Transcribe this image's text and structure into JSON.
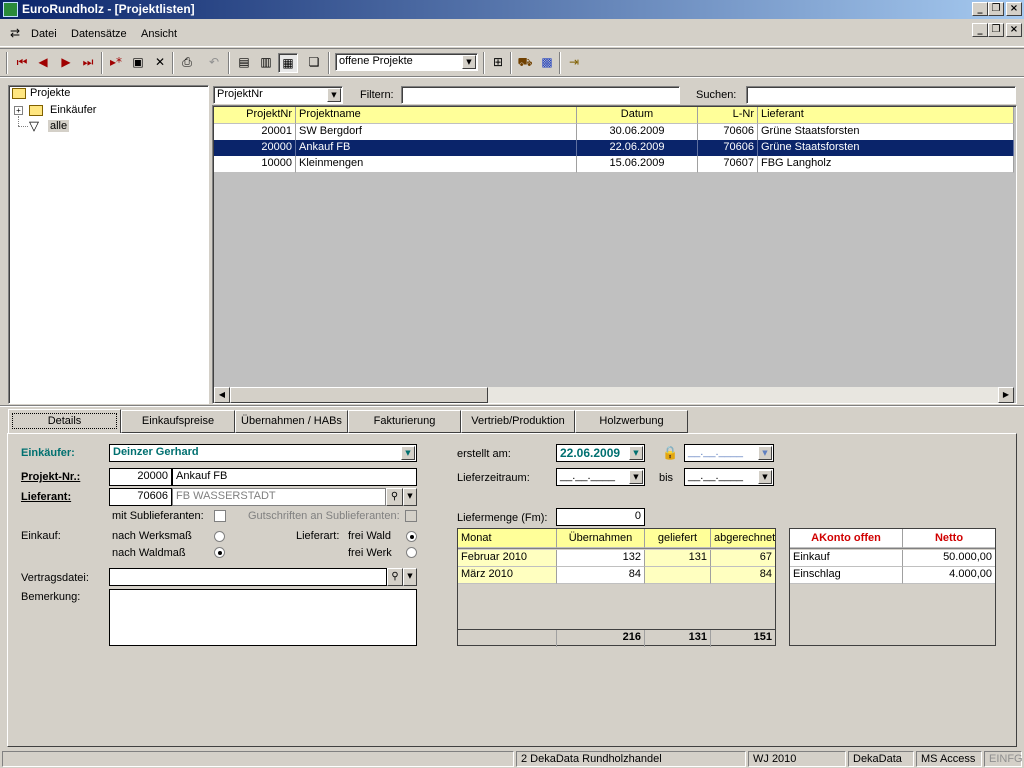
{
  "window": {
    "title": "EuroRundholz - [Projektlisten]"
  },
  "menu": {
    "items": [
      "Datei",
      "Datensätze",
      "Ansicht"
    ]
  },
  "toolbar": {
    "filter_combo": "offene Projekte"
  },
  "tree": {
    "root": "Projekte",
    "child1": "Einkäufer",
    "child2": "alle"
  },
  "list": {
    "sort_combo": "ProjektNr",
    "filter_label": "Filtern:",
    "search_label": "Suchen:",
    "columns": [
      "ProjektNr",
      "Projektname",
      "Datum",
      "L-Nr",
      "Lieferant"
    ],
    "rows": [
      [
        "20001",
        "SW Bergdorf",
        "30.06.2009",
        "70606",
        "Grüne Staatsforsten"
      ],
      [
        "20000",
        "Ankauf FB",
        "22.06.2009",
        "70606",
        "Grüne Staatsforsten"
      ],
      [
        "10000",
        "Kleinmengen",
        "15.06.2009",
        "70607",
        "FBG Langholz"
      ]
    ]
  },
  "tabs": [
    "Details",
    "Einkaufspreise",
    "Übernahmen / HABs",
    "Fakturierung",
    "Vertrieb/Produktion",
    "Holzwerbung"
  ],
  "details": {
    "einkaeufer_label": "Einkäufer:",
    "einkaeufer_value": "Deinzer Gerhard",
    "projekt_label": "Projekt-Nr.:",
    "projekt_nr": "20000",
    "projekt_name": "Ankauf FB",
    "lieferant_label": "Lieferant:",
    "lieferant_nr": "70606",
    "lieferant_name": "FB WASSERSTADT",
    "sublieferanten_label": "mit Sublieferanten:",
    "gutschriften_label": "Gutschriften an Sublieferanten:",
    "einkauf_label": "Einkauf:",
    "werksmass": "nach Werksmaß",
    "waldmass": "nach Waldmaß",
    "lieferart_label": "Lieferart:",
    "frei_wald": "frei Wald",
    "frei_werk": "frei Werk",
    "vertragsdatei_label": "Vertragsdatei:",
    "bemerkung_label": "Bemerkung:",
    "erstellt_label": "erstellt am:",
    "erstellt_value": "22.06.2009",
    "empty_date": "__.__.____",
    "lieferzeitraum_label": "Lieferzeitraum:",
    "bis_label": "bis",
    "liefermenge_label": "Liefermenge (Fm):",
    "liefermenge_value": "0"
  },
  "monthly": {
    "columns": [
      "Monat",
      "Übernahmen",
      "geliefert",
      "abgerechnet"
    ],
    "rows": [
      [
        "Februar 2010",
        "132",
        "131",
        "67"
      ],
      [
        "März 2010",
        "84",
        "",
        "84"
      ]
    ],
    "totals": [
      "",
      "216",
      "131",
      "151"
    ]
  },
  "akonto": {
    "columns": [
      "AKonto offen",
      "Netto"
    ],
    "rows": [
      [
        "Einkauf",
        "50.000,00"
      ],
      [
        "Einschlag",
        "4.000,00"
      ]
    ]
  },
  "status": {
    "company": "2 DekaData Rundholzhandel",
    "year": "WJ 2010",
    "user": "DekaData",
    "db": "MS Access",
    "mode": "EINFG"
  },
  "colors": {
    "selection": "#0a246a",
    "header_yellow": "#ffff99",
    "accent_teal": "#007070",
    "accent_red": "#d00000"
  }
}
